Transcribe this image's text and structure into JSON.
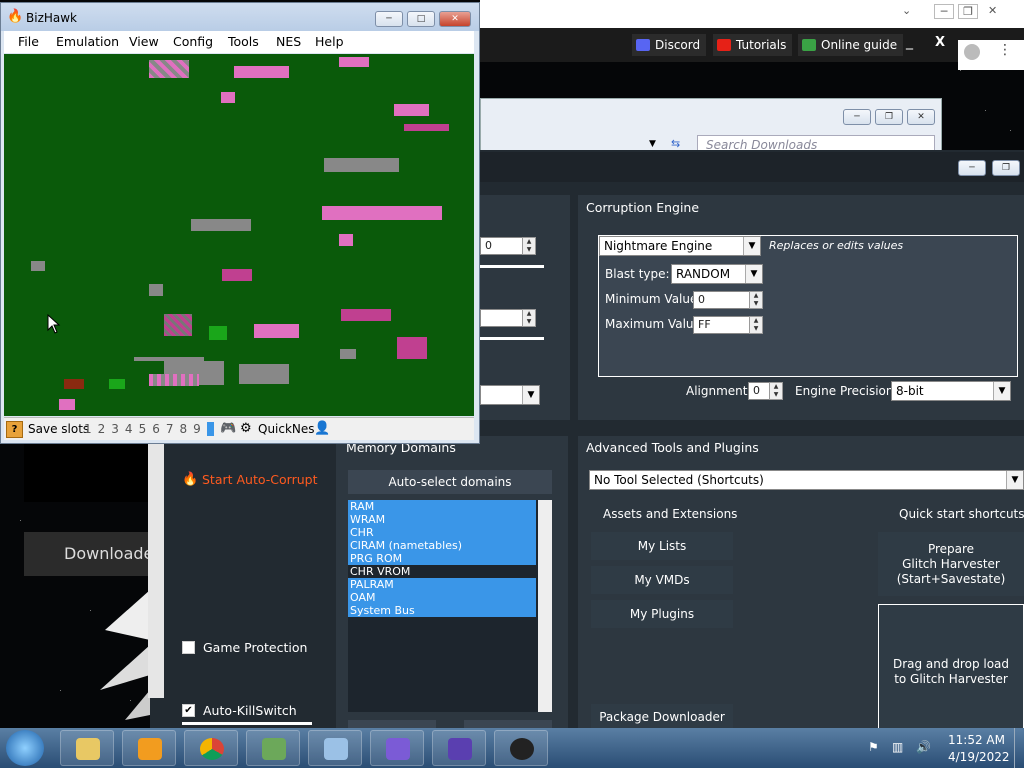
{
  "bizhawk": {
    "title": "BizHawk",
    "menu": [
      "File",
      "Emulation",
      "View",
      "Config",
      "Tools",
      "NES",
      "Help"
    ],
    "status": {
      "save_slots_label": "Save slots",
      "slots": [
        "1",
        "2",
        "3",
        "4",
        "5",
        "6",
        "7",
        "8",
        "9",
        "0"
      ],
      "core": "QuickNes"
    }
  },
  "browser": {
    "top_buttons": [
      {
        "label": "Discord",
        "color": "#5865f2"
      },
      {
        "label": "Tutorials",
        "color": "#e62117"
      },
      {
        "label": "Online guide",
        "color": "#3aa245"
      }
    ],
    "search_placeholder": "Search Downloads"
  },
  "rtc": {
    "corruption_engine": {
      "title": "Corruption Engine",
      "engine": "Nightmare Engine",
      "engine_desc": "Replaces or edits values",
      "blast_type_label": "Blast type:",
      "blast_type": "RANDOM",
      "min_label": "Minimum Value",
      "min_value": "0",
      "max_label": "Maximum Value",
      "max_value": "FF",
      "alignment_label": "Alignment:",
      "alignment_value": "0",
      "precision_label": "Engine Precision:",
      "precision_value": "8-bit"
    },
    "left_values": {
      "top_spin": "0"
    },
    "advanced": {
      "title": "Advanced Tools and Plugins",
      "tool_select": "No Tool Selected (Shortcuts)",
      "assets_title": "Assets and Extensions",
      "buttons": [
        "My Lists",
        "My VMDs",
        "My Plugins"
      ],
      "package_downloader": "Package Downloader",
      "quick_start_title": "Quick start shortcuts",
      "prepare_line1": "Prepare",
      "prepare_line2": "Glitch Harvester",
      "prepare_line3": "(Start+Savestate)",
      "drag_line1": "Drag and drop load",
      "drag_line2": "to Glitch Harvester"
    },
    "memory": {
      "title": "Memory Domains",
      "auto_select": "Auto-select domains",
      "domains": [
        {
          "name": "RAM",
          "selected": true
        },
        {
          "name": "WRAM",
          "selected": true
        },
        {
          "name": "CHR",
          "selected": true
        },
        {
          "name": "CIRAM (nametables)",
          "selected": true
        },
        {
          "name": "PRG ROM",
          "selected": true
        },
        {
          "name": "CHR VROM",
          "selected": false
        },
        {
          "name": "PALRAM",
          "selected": true
        },
        {
          "name": "OAM",
          "selected": true
        },
        {
          "name": "System Bus",
          "selected": true
        }
      ]
    },
    "side": {
      "start_auto_corrupt": "Start Auto-Corrupt",
      "game_protection": "Game Protection",
      "auto_killswitch": "Auto-KillSwitch",
      "downloads_label": "Downloade"
    }
  },
  "taskbar": {
    "time": "11:52 AM",
    "date": "4/19/2022"
  }
}
